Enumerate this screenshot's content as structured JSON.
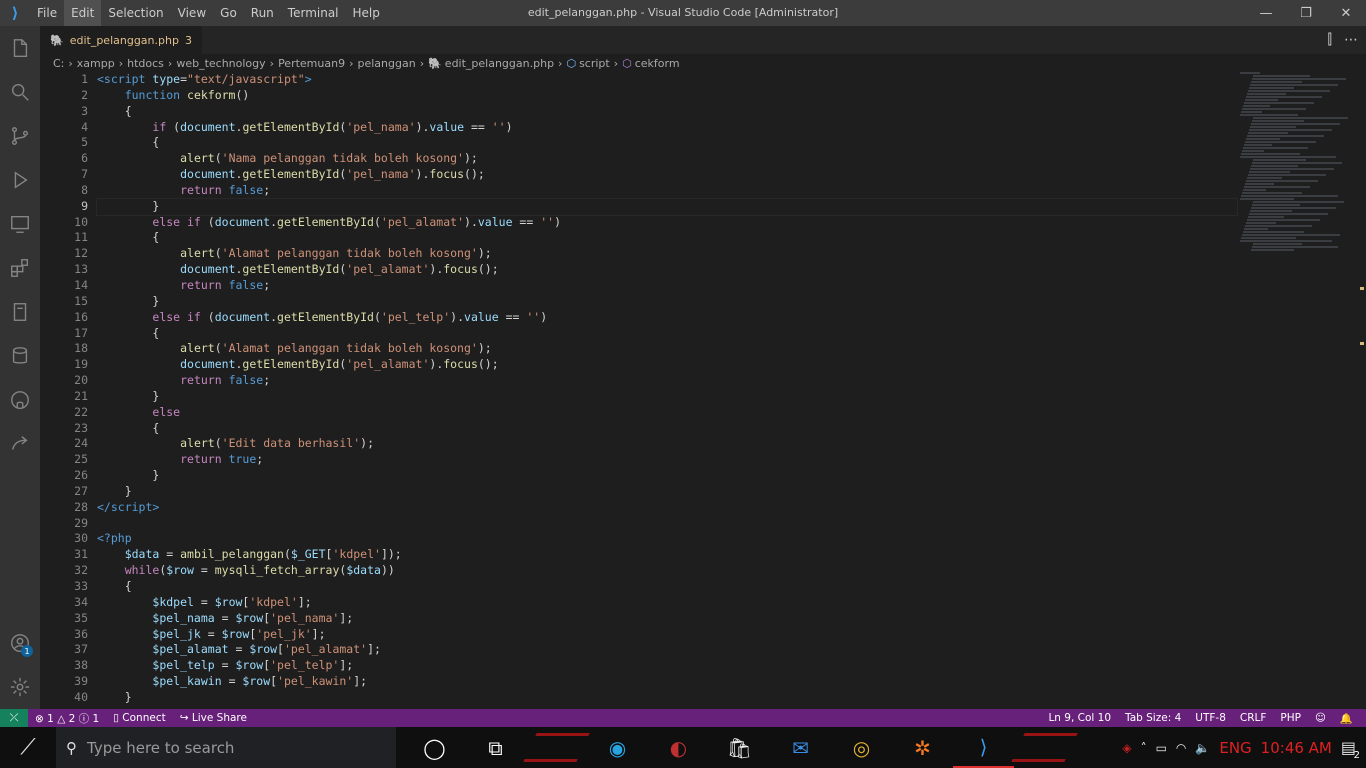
{
  "titlebar": {
    "logo_icon": "vscode-logo-icon",
    "menu": [
      "File",
      "Edit",
      "Selection",
      "View",
      "Go",
      "Run",
      "Terminal",
      "Help"
    ],
    "active_menu": "Edit",
    "window_title": "edit_pelanggan.php - Visual Studio Code [Administrator]",
    "minimize": "—",
    "maximize": "❐",
    "close": "✕"
  },
  "activitybar": {
    "items": [
      "explorer-icon",
      "search-icon",
      "source-control-icon",
      "run-debug-icon",
      "remote-explorer-icon",
      "extensions-icon",
      "notebook-icon",
      "database-icon",
      "github-icon",
      "live-share-icon"
    ],
    "bottom": [
      "account-icon",
      "settings-gear-icon"
    ],
    "account_badge": "1"
  },
  "tabs": [
    {
      "label": "edit_pelanggan.php",
      "problems": "3"
    }
  ],
  "tab_actions": [
    "⫿",
    "⋯"
  ],
  "breadcrumb": {
    "parts": [
      "C:",
      "xampp",
      "htdocs",
      "web_technology",
      "Pertemuan9",
      "pelanggan"
    ],
    "file": "edit_pelanggan.php",
    "symbol1": "script",
    "symbol2": "cekform"
  },
  "editor": {
    "current_line": 9,
    "line_numbers": [
      "1",
      "2",
      "3",
      "4",
      "5",
      "6",
      "7",
      "8",
      "9",
      "10",
      "11",
      "12",
      "13",
      "14",
      "15",
      "16",
      "17",
      "18",
      "19",
      "20",
      "21",
      "22",
      "23",
      "24",
      "25",
      "26",
      "27",
      "28",
      "29",
      "30",
      "31",
      "32",
      "33",
      "34",
      "35",
      "36",
      "37",
      "38",
      "39",
      "40"
    ],
    "lines": [
      [
        [
          "t-tag",
          "<script "
        ],
        [
          "t-attr",
          "type"
        ],
        [
          "t-pl",
          "="
        ],
        [
          "t-str",
          "\"text/javascript\""
        ],
        [
          "t-tag",
          ">"
        ]
      ],
      [
        [
          "t-pl",
          "    "
        ],
        [
          "t-key",
          "function "
        ],
        [
          "t-fn",
          "cekform"
        ],
        [
          "t-pl",
          "()"
        ]
      ],
      [
        [
          "t-pl",
          "    {"
        ]
      ],
      [
        [
          "t-pl",
          "        "
        ],
        [
          "t-ctl",
          "if "
        ],
        [
          "t-pl",
          "("
        ],
        [
          "t-var",
          "document"
        ],
        [
          "t-pl",
          "."
        ],
        [
          "t-fn",
          "getElementById"
        ],
        [
          "t-pl",
          "("
        ],
        [
          "t-str",
          "'pel_nama'"
        ],
        [
          "t-pl",
          ")."
        ],
        [
          "t-var",
          "value"
        ],
        [
          "t-pl",
          " == "
        ],
        [
          "t-str",
          "''"
        ],
        [
          "t-pl",
          ")"
        ]
      ],
      [
        [
          "t-pl",
          "        {"
        ]
      ],
      [
        [
          "t-pl",
          "            "
        ],
        [
          "t-fn",
          "alert"
        ],
        [
          "t-pl",
          "("
        ],
        [
          "t-str",
          "'Nama pelanggan tidak boleh kosong'"
        ],
        [
          "t-pl",
          ");"
        ]
      ],
      [
        [
          "t-pl",
          "            "
        ],
        [
          "t-var",
          "document"
        ],
        [
          "t-pl",
          "."
        ],
        [
          "t-fn",
          "getElementById"
        ],
        [
          "t-pl",
          "("
        ],
        [
          "t-str",
          "'pel_nama'"
        ],
        [
          "t-pl",
          ")."
        ],
        [
          "t-fn",
          "focus"
        ],
        [
          "t-pl",
          "();"
        ]
      ],
      [
        [
          "t-pl",
          "            "
        ],
        [
          "t-ctl",
          "return "
        ],
        [
          "t-key",
          "false"
        ],
        [
          "t-pl",
          ";"
        ]
      ],
      [
        [
          "t-pl",
          "        }"
        ]
      ],
      [
        [
          "t-pl",
          "        "
        ],
        [
          "t-ctl",
          "else if "
        ],
        [
          "t-pl",
          "("
        ],
        [
          "t-var",
          "document"
        ],
        [
          "t-pl",
          "."
        ],
        [
          "t-fn",
          "getElementById"
        ],
        [
          "t-pl",
          "("
        ],
        [
          "t-str",
          "'pel_alamat'"
        ],
        [
          "t-pl",
          ")."
        ],
        [
          "t-var",
          "value"
        ],
        [
          "t-pl",
          " == "
        ],
        [
          "t-str",
          "''"
        ],
        [
          "t-pl",
          ")"
        ]
      ],
      [
        [
          "t-pl",
          "        {"
        ]
      ],
      [
        [
          "t-pl",
          "            "
        ],
        [
          "t-fn",
          "alert"
        ],
        [
          "t-pl",
          "("
        ],
        [
          "t-str",
          "'Alamat pelanggan tidak boleh kosong'"
        ],
        [
          "t-pl",
          ");"
        ]
      ],
      [
        [
          "t-pl",
          "            "
        ],
        [
          "t-var",
          "document"
        ],
        [
          "t-pl",
          "."
        ],
        [
          "t-fn",
          "getElementById"
        ],
        [
          "t-pl",
          "("
        ],
        [
          "t-str",
          "'pel_alamat'"
        ],
        [
          "t-pl",
          ")."
        ],
        [
          "t-fn",
          "focus"
        ],
        [
          "t-pl",
          "();"
        ]
      ],
      [
        [
          "t-pl",
          "            "
        ],
        [
          "t-ctl",
          "return "
        ],
        [
          "t-key",
          "false"
        ],
        [
          "t-pl",
          ";"
        ]
      ],
      [
        [
          "t-pl",
          "        }"
        ]
      ],
      [
        [
          "t-pl",
          "        "
        ],
        [
          "t-ctl",
          "else if "
        ],
        [
          "t-pl",
          "("
        ],
        [
          "t-var",
          "document"
        ],
        [
          "t-pl",
          "."
        ],
        [
          "t-fn",
          "getElementById"
        ],
        [
          "t-pl",
          "("
        ],
        [
          "t-str",
          "'pel_telp'"
        ],
        [
          "t-pl",
          ")."
        ],
        [
          "t-var",
          "value"
        ],
        [
          "t-pl",
          " == "
        ],
        [
          "t-str",
          "''"
        ],
        [
          "t-pl",
          ")"
        ]
      ],
      [
        [
          "t-pl",
          "        {"
        ]
      ],
      [
        [
          "t-pl",
          "            "
        ],
        [
          "t-fn",
          "alert"
        ],
        [
          "t-pl",
          "("
        ],
        [
          "t-str",
          "'Alamat pelanggan tidak boleh kosong'"
        ],
        [
          "t-pl",
          ");"
        ]
      ],
      [
        [
          "t-pl",
          "            "
        ],
        [
          "t-var",
          "document"
        ],
        [
          "t-pl",
          "."
        ],
        [
          "t-fn",
          "getElementById"
        ],
        [
          "t-pl",
          "("
        ],
        [
          "t-str",
          "'pel_alamat'"
        ],
        [
          "t-pl",
          ")."
        ],
        [
          "t-fn",
          "focus"
        ],
        [
          "t-pl",
          "();"
        ]
      ],
      [
        [
          "t-pl",
          "            "
        ],
        [
          "t-ctl",
          "return "
        ],
        [
          "t-key",
          "false"
        ],
        [
          "t-pl",
          ";"
        ]
      ],
      [
        [
          "t-pl",
          "        }"
        ]
      ],
      [
        [
          "t-pl",
          "        "
        ],
        [
          "t-ctl",
          "else"
        ]
      ],
      [
        [
          "t-pl",
          "        {"
        ]
      ],
      [
        [
          "t-pl",
          "            "
        ],
        [
          "t-fn",
          "alert"
        ],
        [
          "t-pl",
          "("
        ],
        [
          "t-str",
          "'Edit data berhasil'"
        ],
        [
          "t-pl",
          ");"
        ]
      ],
      [
        [
          "t-pl",
          "            "
        ],
        [
          "t-ctl",
          "return "
        ],
        [
          "t-key",
          "true"
        ],
        [
          "t-pl",
          ";"
        ]
      ],
      [
        [
          "t-pl",
          "        }"
        ]
      ],
      [
        [
          "t-pl",
          "    }"
        ]
      ],
      [
        [
          "t-tag",
          "</"
        ],
        [
          "t-tag",
          "script"
        ],
        [
          "t-tag",
          ">"
        ]
      ],
      [
        [
          "t-pl",
          ""
        ]
      ],
      [
        [
          "t-php",
          "<?php"
        ]
      ],
      [
        [
          "t-pl",
          "    "
        ],
        [
          "t-var",
          "$data"
        ],
        [
          "t-pl",
          " = "
        ],
        [
          "t-fn",
          "ambil_pelanggan"
        ],
        [
          "t-pl",
          "("
        ],
        [
          "t-var",
          "$_GET"
        ],
        [
          "t-pl",
          "["
        ],
        [
          "t-str",
          "'kdpel'"
        ],
        [
          "t-pl",
          "]);"
        ]
      ],
      [
        [
          "t-pl",
          "    "
        ],
        [
          "t-ctl",
          "while"
        ],
        [
          "t-pl",
          "("
        ],
        [
          "t-var",
          "$row"
        ],
        [
          "t-pl",
          " = "
        ],
        [
          "t-fn",
          "mysqli_fetch_array"
        ],
        [
          "t-pl",
          "("
        ],
        [
          "t-var",
          "$data"
        ],
        [
          "t-pl",
          "))"
        ]
      ],
      [
        [
          "t-pl",
          "    {"
        ]
      ],
      [
        [
          "t-pl",
          "        "
        ],
        [
          "t-var",
          "$kdpel"
        ],
        [
          "t-pl",
          " = "
        ],
        [
          "t-var",
          "$row"
        ],
        [
          "t-pl",
          "["
        ],
        [
          "t-str",
          "'kdpel'"
        ],
        [
          "t-pl",
          "];"
        ]
      ],
      [
        [
          "t-pl",
          "        "
        ],
        [
          "t-var",
          "$pel_nama"
        ],
        [
          "t-pl",
          " = "
        ],
        [
          "t-var",
          "$row"
        ],
        [
          "t-pl",
          "["
        ],
        [
          "t-str",
          "'pel_nama'"
        ],
        [
          "t-pl",
          "];"
        ]
      ],
      [
        [
          "t-pl",
          "        "
        ],
        [
          "t-var",
          "$pel_jk"
        ],
        [
          "t-pl",
          " = "
        ],
        [
          "t-var",
          "$row"
        ],
        [
          "t-pl",
          "["
        ],
        [
          "t-str",
          "'pel_jk'"
        ],
        [
          "t-pl",
          "];"
        ]
      ],
      [
        [
          "t-pl",
          "        "
        ],
        [
          "t-var",
          "$pel_alamat"
        ],
        [
          "t-pl",
          " = "
        ],
        [
          "t-var",
          "$row"
        ],
        [
          "t-pl",
          "["
        ],
        [
          "t-str",
          "'pel_alamat'"
        ],
        [
          "t-pl",
          "];"
        ]
      ],
      [
        [
          "t-pl",
          "        "
        ],
        [
          "t-var",
          "$pel_telp"
        ],
        [
          "t-pl",
          " = "
        ],
        [
          "t-var",
          "$row"
        ],
        [
          "t-pl",
          "["
        ],
        [
          "t-str",
          "'pel_telp'"
        ],
        [
          "t-pl",
          "];"
        ]
      ],
      [
        [
          "t-pl",
          "        "
        ],
        [
          "t-var",
          "$pel_kawin"
        ],
        [
          "t-pl",
          " = "
        ],
        [
          "t-var",
          "$row"
        ],
        [
          "t-pl",
          "["
        ],
        [
          "t-str",
          "'pel_kawin'"
        ],
        [
          "t-pl",
          "];"
        ]
      ],
      [
        [
          "t-pl",
          "    }"
        ]
      ]
    ]
  },
  "statusbar": {
    "remote_icon": "remote-icon",
    "errors": "1",
    "warnings": "2",
    "infos": "1",
    "connect": "Connect",
    "live_share": "Live Share",
    "position": "Ln 9, Col 10",
    "tab_size": "Tab Size: 4",
    "encoding": "UTF-8",
    "eol": "CRLF",
    "language": "PHP"
  },
  "taskbar": {
    "search_placeholder": "Type here to search",
    "apps": [
      "cortana-icon",
      "task-view-icon",
      "game-icon",
      "edge-icon",
      "helmet-icon",
      "store-icon",
      "mail-icon",
      "chrome-icon",
      "xampp-icon",
      "vscode-icon",
      "game2-icon"
    ],
    "tray": {
      "language": "ENG",
      "time": "10:46 AM",
      "notifications": "2"
    }
  },
  "colors": {
    "statusbar": "#68217a",
    "remote": "#16825d",
    "taskbar_accent": "#e02020"
  }
}
